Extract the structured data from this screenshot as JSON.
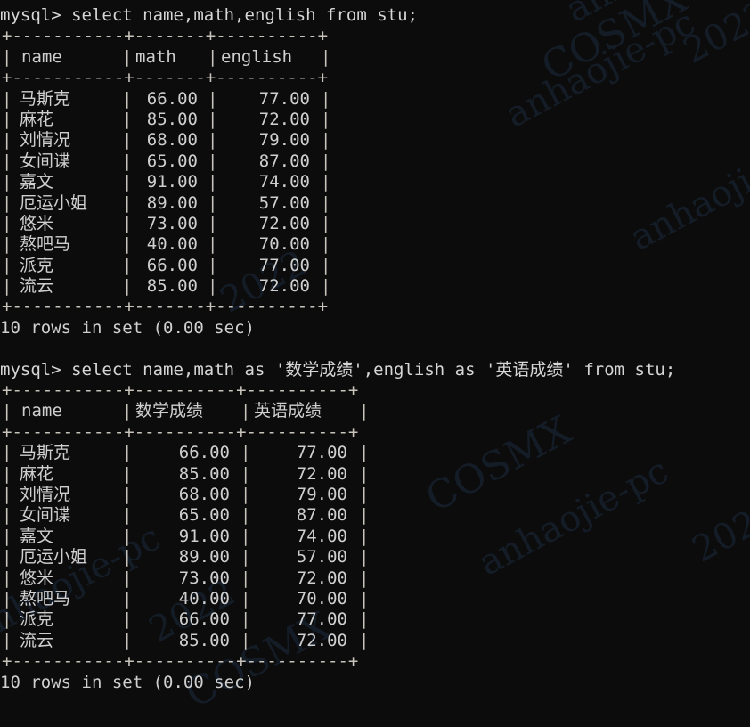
{
  "terminal": {
    "background_color": "#0c0c0c",
    "text_color": "#cfcfcf",
    "border_color": "#c9c4bb",
    "prompt": "mysql>"
  },
  "watermark": {
    "color": "#16202c",
    "texts": [
      "anhaojie-pc",
      "2022",
      "COSMX"
    ]
  },
  "blocks": [
    {
      "command": "mysql> select name,math,english from stu;",
      "rule": "+----------+--------+---------+",
      "header": "| name     | math   | english |",
      "columns": [
        "name",
        "math",
        "english"
      ],
      "rows": [
        {
          "name": "马斯克",
          "math": "66.00",
          "english": "77.00"
        },
        {
          "name": "麻花",
          "math": "85.00",
          "english": "72.00"
        },
        {
          "name": "刘情况",
          "math": "68.00",
          "english": "79.00"
        },
        {
          "name": "女间谍",
          "math": "65.00",
          "english": "87.00"
        },
        {
          "name": "嘉文",
          "math": "91.00",
          "english": "74.00"
        },
        {
          "name": "厄运小姐",
          "math": "89.00",
          "english": "57.00"
        },
        {
          "name": "悠米",
          "math": "73.00",
          "english": "72.00"
        },
        {
          "name": "熬吧马",
          "math": "40.00",
          "english": "70.00"
        },
        {
          "name": "派克",
          "math": "66.00",
          "english": "77.00"
        },
        {
          "name": "流云",
          "math": "85.00",
          "english": "72.00"
        }
      ],
      "status": "10 rows in set (0.00 sec)"
    },
    {
      "command": "mysql> select name,math as '数学成绩',english as '英语成绩' from stu;",
      "rule": "+----------+------------+------------+",
      "header": "| name     | 数学成绩   | 英语成绩   |",
      "columns": [
        "name",
        "数学成绩",
        "英语成绩"
      ],
      "rows": [
        {
          "name": "马斯克",
          "math": "66.00",
          "english": "77.00"
        },
        {
          "name": "麻花",
          "math": "85.00",
          "english": "72.00"
        },
        {
          "name": "刘情况",
          "math": "68.00",
          "english": "79.00"
        },
        {
          "name": "女间谍",
          "math": "65.00",
          "english": "87.00"
        },
        {
          "name": "嘉文",
          "math": "91.00",
          "english": "74.00"
        },
        {
          "name": "厄运小姐",
          "math": "89.00",
          "english": "57.00"
        },
        {
          "name": "悠米",
          "math": "73.00",
          "english": "72.00"
        },
        {
          "name": "熬吧马",
          "math": "40.00",
          "english": "70.00"
        },
        {
          "name": "派克",
          "math": "66.00",
          "english": "77.00"
        },
        {
          "name": "流云",
          "math": "85.00",
          "english": "72.00"
        }
      ],
      "status": "10 rows in set (0.00 sec)"
    }
  ]
}
